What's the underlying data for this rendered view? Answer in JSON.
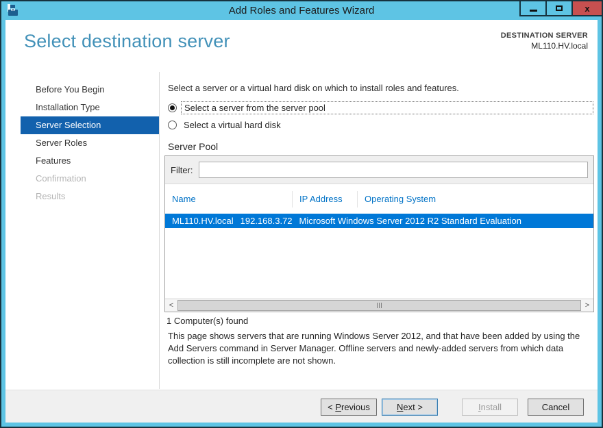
{
  "colors": {
    "titlebar_teal": "#5EC4E4",
    "close_button_red": "#C75050",
    "heading_blue": "#4291B8",
    "sidebar_selected_blue": "#1261AD",
    "row_selected_blue": "#0078D7",
    "table_header_link_blue": "#0072C6"
  },
  "window": {
    "title": "Add Roles and Features Wizard",
    "close_glyph": "x"
  },
  "header": {
    "title": "Select destination server",
    "destination_label": "DESTINATION SERVER",
    "destination_value": "ML110.HV.local"
  },
  "sidebar": {
    "items": [
      {
        "label": "Before You Begin",
        "state": "normal"
      },
      {
        "label": "Installation Type",
        "state": "normal"
      },
      {
        "label": "Server Selection",
        "state": "selected"
      },
      {
        "label": "Server Roles",
        "state": "normal"
      },
      {
        "label": "Features",
        "state": "normal"
      },
      {
        "label": "Confirmation",
        "state": "disabled"
      },
      {
        "label": "Results",
        "state": "disabled"
      }
    ]
  },
  "main": {
    "intro": "Select a server or a virtual hard disk on which to install roles and features.",
    "radios": [
      {
        "label": "Select a server from the server pool",
        "selected": true
      },
      {
        "label": "Select a virtual hard disk",
        "selected": false
      }
    ],
    "server_pool": {
      "label": "Server Pool",
      "filter_label": "Filter:",
      "filter_value": "",
      "columns": [
        "Name",
        "IP Address",
        "Operating System"
      ],
      "rows": [
        {
          "name": "ML110.HV.local",
          "ip": "192.168.3.72",
          "os": "Microsoft Windows Server 2012 R2 Standard Evaluation",
          "selected": true
        }
      ],
      "scrollbar": {
        "left_glyph": "<",
        "right_glyph": ">"
      }
    },
    "count_text": "1 Computer(s) found",
    "description": "This page shows servers that are running Windows Server 2012, and that have been added by using the Add Servers command in Server Manager. Offline servers and newly-added servers from which data collection is still incomplete are not shown."
  },
  "footer": {
    "previous": {
      "pre": "< ",
      "key": "P",
      "rest": "revious"
    },
    "next": {
      "key": "N",
      "rest": "ext >"
    },
    "install": {
      "key": "I",
      "rest": "nstall"
    },
    "cancel": {
      "label": "Cancel"
    }
  }
}
